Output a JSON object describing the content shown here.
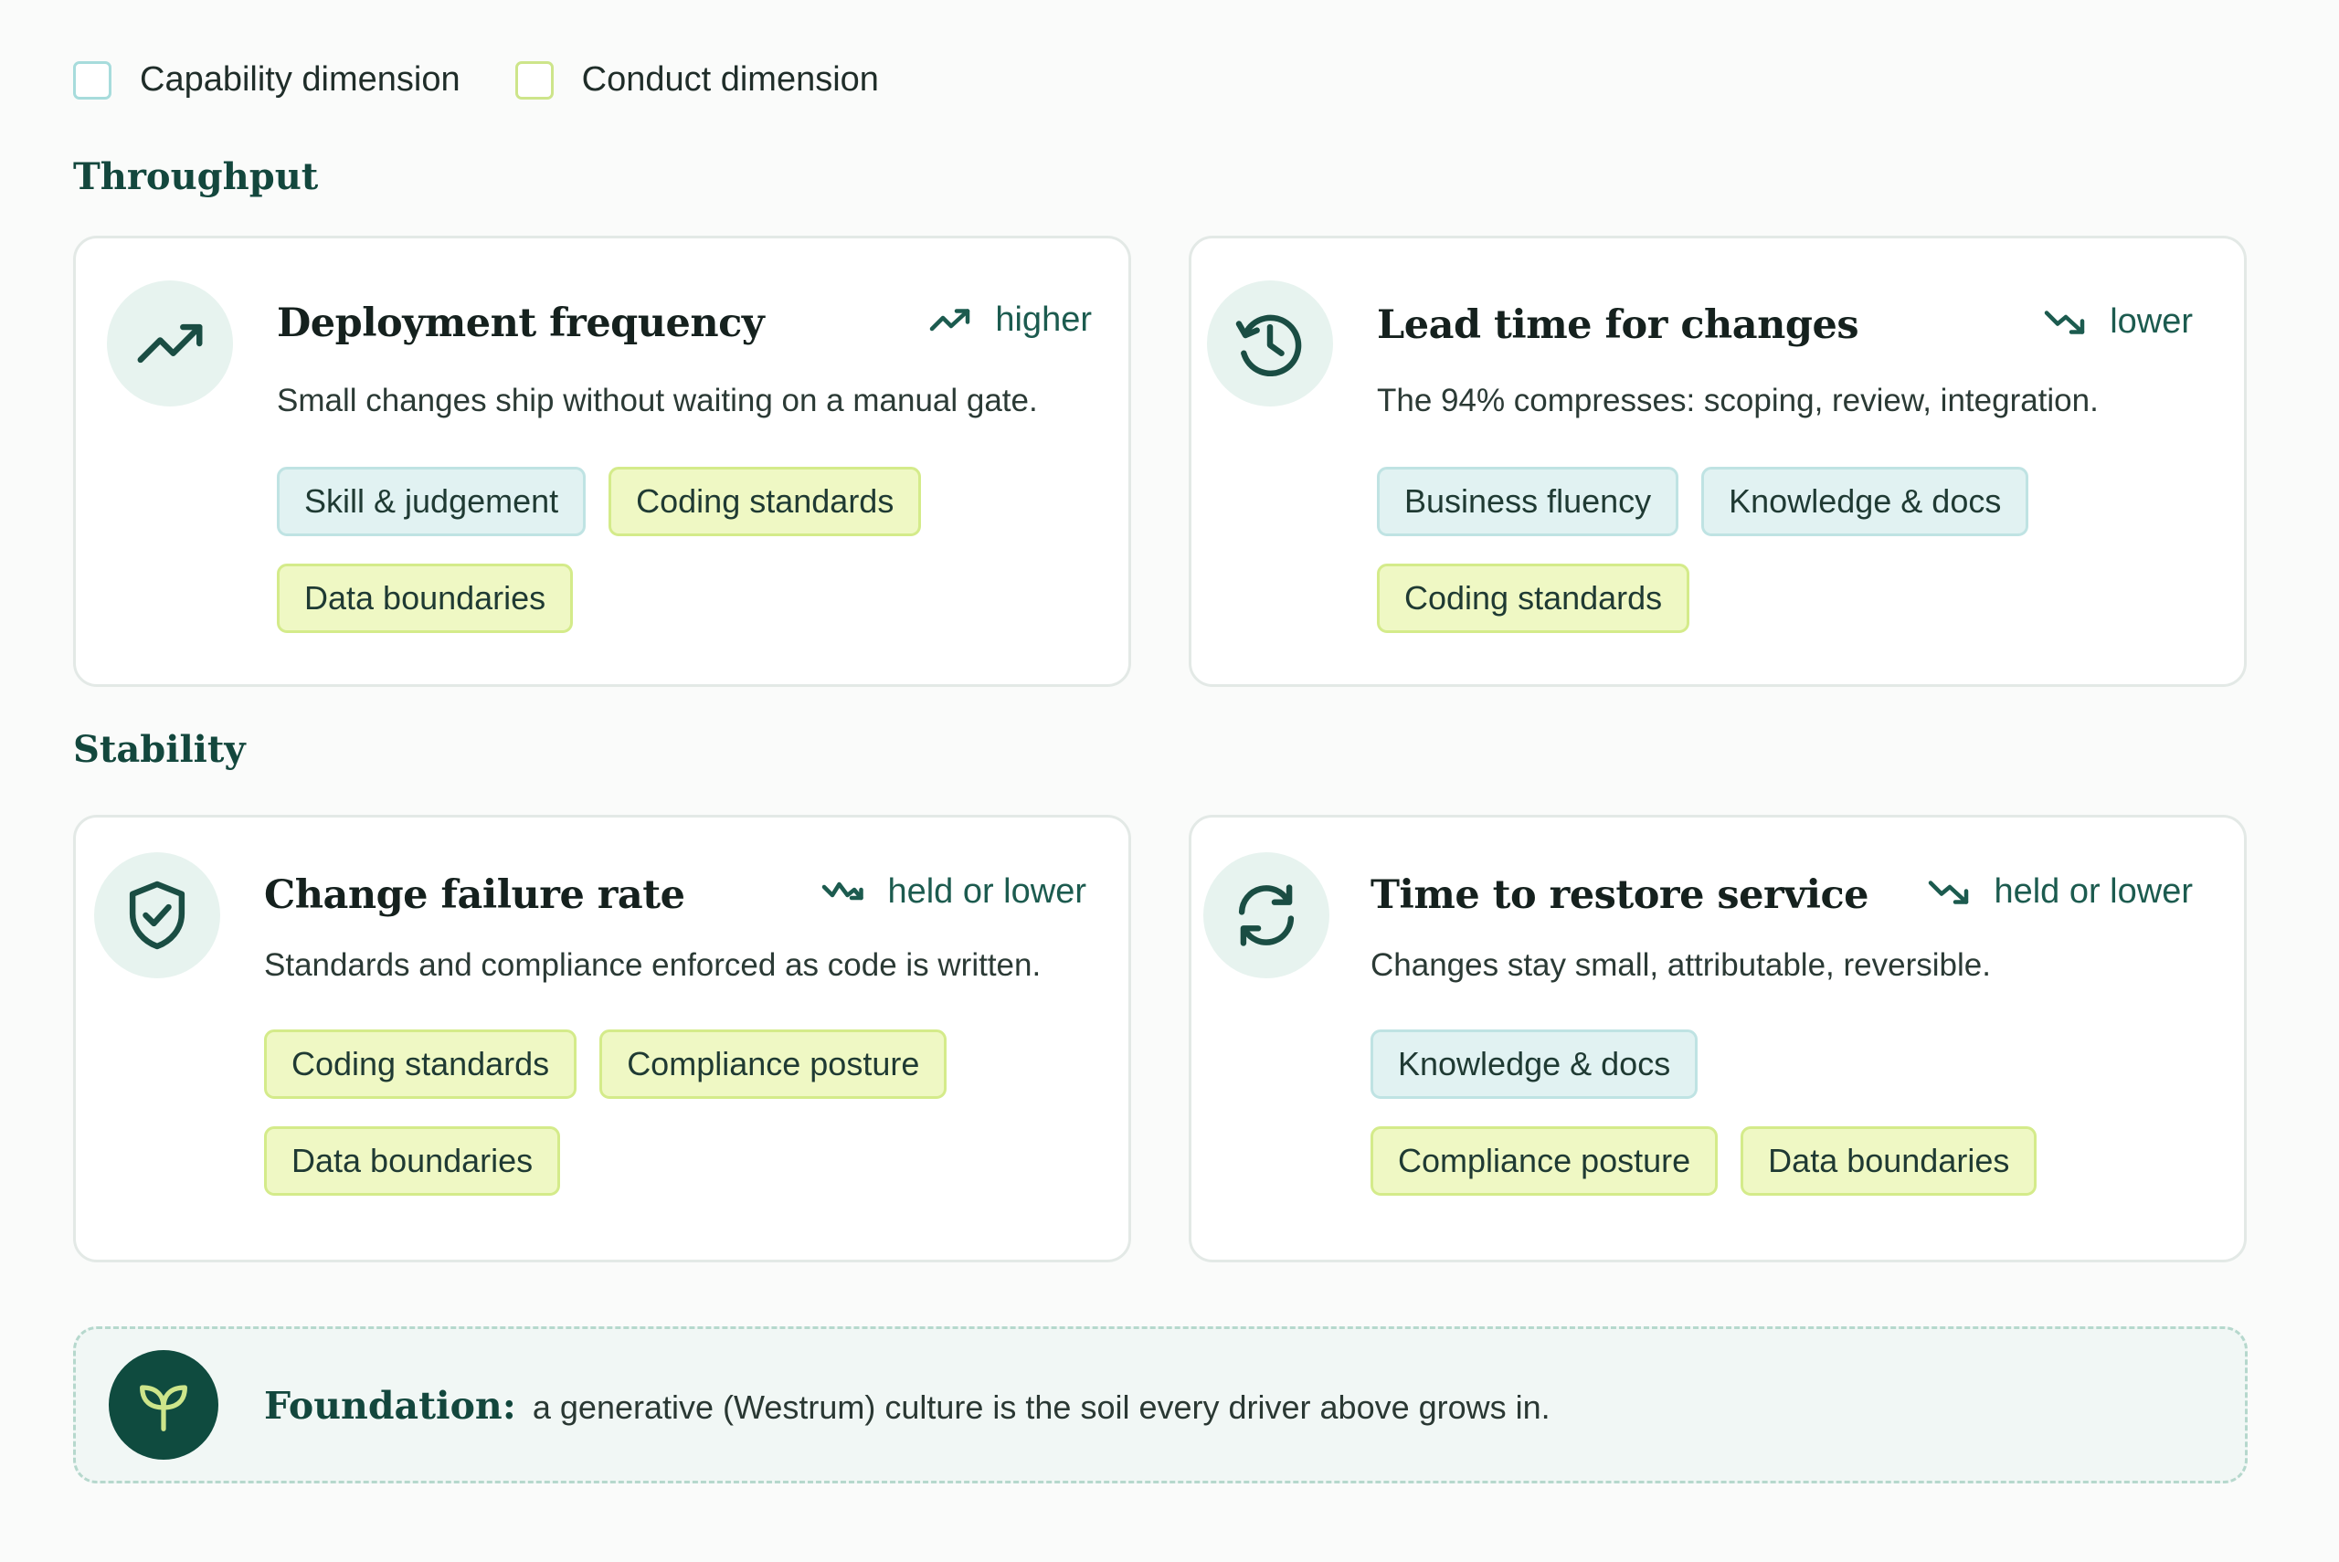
{
  "legend": {
    "capability_label": "Capability dimension",
    "conduct_label": "Conduct dimension"
  },
  "sections": {
    "throughput_title": "Throughput",
    "stability_title": "Stability"
  },
  "cards": {
    "deployment": {
      "icon": "trending-up-icon",
      "title": "Deployment frequency",
      "trend_icon": "trend-up-icon",
      "trend": "higher",
      "description": "Small changes ship without waiting on a manual gate.",
      "tags": [
        {
          "label": "Skill & judgement",
          "kind": "capability"
        },
        {
          "label": "Coding standards",
          "kind": "conduct"
        },
        {
          "label": "Data boundaries",
          "kind": "conduct"
        }
      ]
    },
    "lead_time": {
      "icon": "history-clock-icon",
      "title": "Lead time for changes",
      "trend_icon": "trend-down-icon",
      "trend": "lower",
      "description": "The 94% compresses: scoping, review, integration.",
      "tags": [
        {
          "label": "Business fluency",
          "kind": "capability"
        },
        {
          "label": "Knowledge & docs",
          "kind": "capability"
        },
        {
          "label": "Coding standards",
          "kind": "conduct"
        }
      ]
    },
    "failure_rate": {
      "icon": "shield-check-icon",
      "title": "Change failure rate",
      "trend_icon": "trend-zigzag-down-icon",
      "trend": "held or lower",
      "description": "Standards and compliance enforced as code is written.",
      "tags": [
        {
          "label": "Coding standards",
          "kind": "conduct"
        },
        {
          "label": "Compliance posture",
          "kind": "conduct"
        },
        {
          "label": "Data boundaries",
          "kind": "conduct"
        }
      ]
    },
    "restore": {
      "icon": "refresh-icon",
      "title": "Time to restore service",
      "trend_icon": "trend-down-icon",
      "trend": "held or lower",
      "description": "Changes stay small, attributable, reversible.",
      "tags": [
        {
          "label": "Knowledge & docs",
          "kind": "capability"
        },
        {
          "label": "Compliance posture",
          "kind": "conduct"
        },
        {
          "label": "Data boundaries",
          "kind": "conduct"
        }
      ]
    }
  },
  "foundation": {
    "icon": "sprout-icon",
    "label": "Foundation:",
    "text": "a generative (Westrum) culture is the soil every driver above grows in."
  },
  "colors": {
    "accent": "#13473d",
    "capability_tag_bg": "#e1f2f2",
    "conduct_tag_bg": "#eff8c4"
  }
}
